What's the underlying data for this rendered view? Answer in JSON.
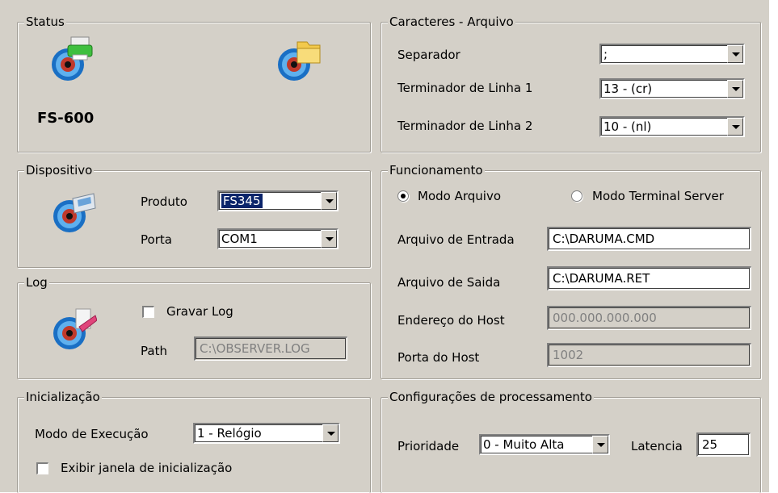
{
  "status": {
    "title": "Status",
    "model": "FS-600",
    "icons": [
      "printer-eye-icon",
      "folder-eye-icon"
    ]
  },
  "caracteres": {
    "title": "Caracteres - Arquivo",
    "separador_label": "Separador",
    "separador_value": ";",
    "term1_label": "Terminador de Linha 1",
    "term1_value": "13 - (cr)",
    "term2_label": "Terminador de Linha 2",
    "term2_value": "10 - (nl)"
  },
  "dispositivo": {
    "title": "Dispositivo",
    "produto_label": "Produto",
    "produto_value": "FS345",
    "porta_label": "Porta",
    "porta_value": "COM1",
    "icon": "device-eye-icon"
  },
  "funcionamento": {
    "title": "Funcionamento",
    "radio_arquivo": "Modo Arquivo",
    "radio_terminal": "Modo Terminal Server",
    "selected_mode": "Modo Arquivo",
    "entrada_label": "Arquivo de Entrada",
    "entrada_value": "C:\\DARUMA.CMD",
    "saida_label": "Arquivo de Saida",
    "saida_value": "C:\\DARUMA.RET",
    "host_label": "Endereço do Host",
    "host_value": "000.000.000.000",
    "porta_host_label": "Porta do Host",
    "porta_host_value": "1002"
  },
  "log": {
    "title": "Log",
    "gravar_label": "Gravar Log",
    "gravar_checked": false,
    "path_label": "Path",
    "path_value": "C:\\OBSERVER.LOG",
    "icon": "log-eye-icon"
  },
  "inicializacao": {
    "title": "Inicialização",
    "modo_label": "Modo de Execução",
    "modo_value": "1 - Relógio",
    "exibir_label": "Exibir janela de inicialização",
    "exibir_checked": false
  },
  "processamento": {
    "title": "Configurações de processamento",
    "prioridade_label": "Prioridade",
    "prioridade_value": "0 - Muito Alta",
    "latencia_label": "Latencia",
    "latencia_value": "25"
  },
  "colors": {
    "face": "#d4d0c8",
    "selection": "#0a246a"
  }
}
